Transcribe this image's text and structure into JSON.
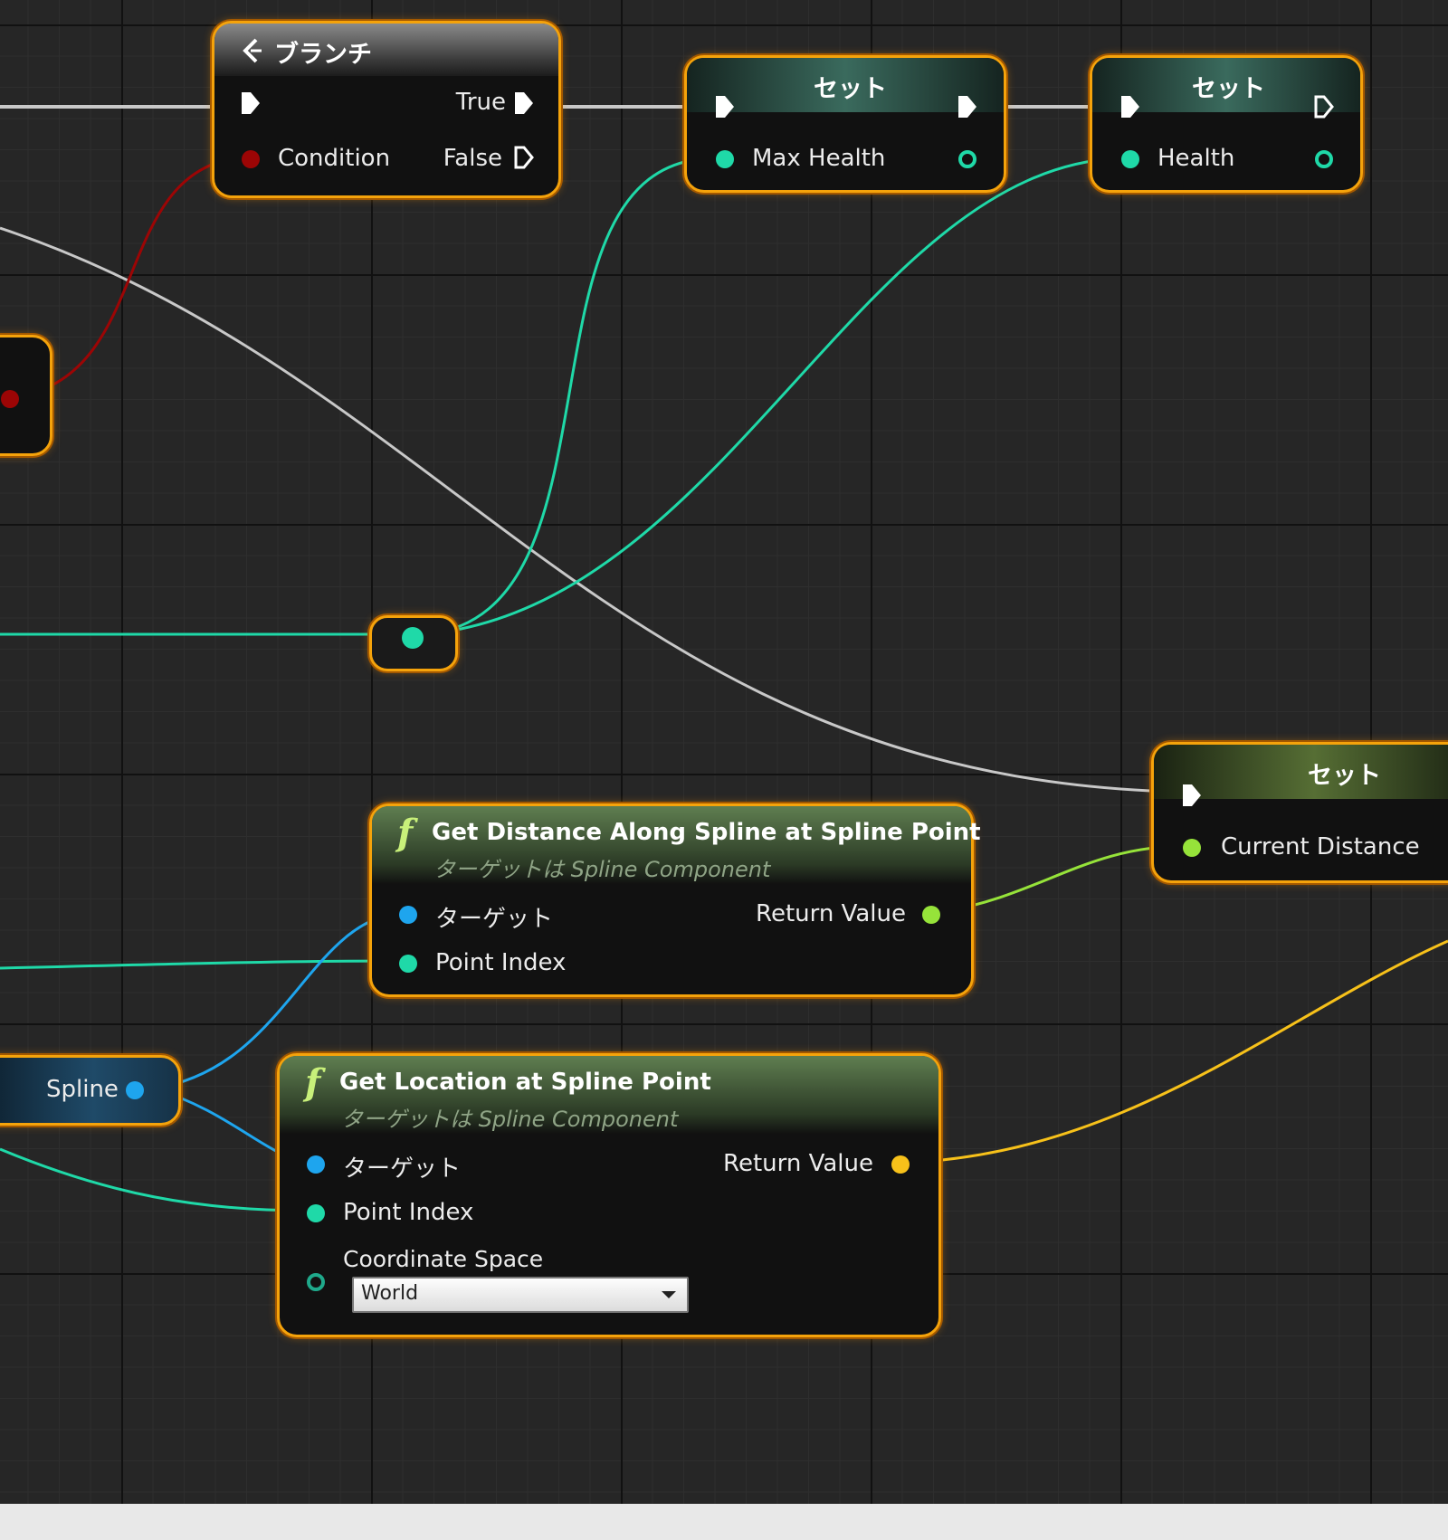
{
  "colors": {
    "exec_wire": "#c8c8c8",
    "bool": "#9c0505",
    "int": "#1fd9a8",
    "float": "#96e33a",
    "object": "#1ea5ee",
    "vector": "#f7c11a",
    "node_border": "#f5a30b"
  },
  "branch_node": {
    "icon": "branch-icon",
    "title": "ブランチ",
    "exec_in": "exec-in-pin",
    "condition_label": "Condition",
    "true_label": "True",
    "false_label": "False"
  },
  "set_max_health": {
    "title": "セット",
    "var_label": "Max Health"
  },
  "set_health": {
    "title": "セット",
    "var_label": "Health"
  },
  "set_current_distance": {
    "title": "セット",
    "var_label": "Current Distance"
  },
  "get_distance_node": {
    "icon": "function-icon",
    "function_symbol": "f",
    "title": "Get Distance Along Spline at Spline Point",
    "subtitle": "ターゲットは Spline Component",
    "target_label": "ターゲット",
    "point_index_label": "Point Index",
    "return_label": "Return Value"
  },
  "get_location_node": {
    "icon": "function-icon",
    "function_symbol": "f",
    "title": "Get Location at Spline Point",
    "subtitle": "ターゲットは Spline Component",
    "target_label": "ターゲット",
    "point_index_label": "Point Index",
    "coordinate_space_label": "Coordinate Space",
    "coordinate_space_value": "World",
    "return_label": "Return Value"
  },
  "spline_var_node": {
    "label": "Spline"
  }
}
